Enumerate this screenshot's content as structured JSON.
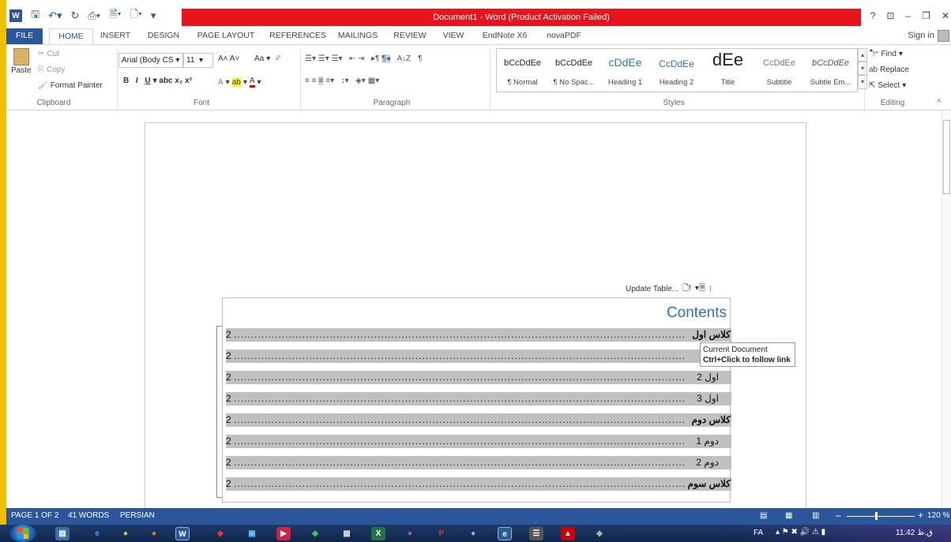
{
  "title_bar": {
    "title": "Document1 - Word (Product Activation Failed)"
  },
  "quick_access": {
    "icons": [
      "word-icon",
      "save-icon",
      "undo-icon",
      "redo-icon",
      "print-preview-icon",
      "new-doc-icon",
      "open-icon",
      "customize-icon"
    ]
  },
  "window_controls": {
    "help": "?",
    "ribbon_options": "⊡",
    "minimize": "–",
    "restore": "❐",
    "close": "✕"
  },
  "tabs": [
    {
      "label": "FILE"
    },
    {
      "label": "HOME"
    },
    {
      "label": "INSERT"
    },
    {
      "label": "DESIGN"
    },
    {
      "label": "PAGE LAYOUT"
    },
    {
      "label": "REFERENCES"
    },
    {
      "label": "MAILINGS"
    },
    {
      "label": "REVIEW"
    },
    {
      "label": "VIEW"
    },
    {
      "label": "EndNote X6"
    },
    {
      "label": "novaPDF"
    }
  ],
  "sign_in": "Sign in",
  "clipboard": {
    "paste": "Paste",
    "cut": "Cut",
    "copy": "Copy",
    "format_painter": "Format Painter",
    "label": "Clipboard"
  },
  "font": {
    "family": "Arial (Body CS",
    "size": "11",
    "label": "Font",
    "change_case": "Aa"
  },
  "paragraph": {
    "label": "Paragraph"
  },
  "styles": {
    "items": [
      {
        "sample": "bCcDdEe",
        "label": "¶ Normal"
      },
      {
        "sample": "bCcDdEe",
        "label": "¶ No Spac..."
      },
      {
        "sample": "cDdEe",
        "label": "Heading 1"
      },
      {
        "sample": "CcDdEe",
        "label": "Heading 2"
      },
      {
        "sample": "dEe",
        "label": "Title"
      },
      {
        "sample": "CcDdEe",
        "label": "Subtitle"
      },
      {
        "sample": "bCcDdEe",
        "label": "Subtle Em..."
      }
    ],
    "label": "Styles"
  },
  "editing": {
    "find": "Find",
    "replace": "Replace",
    "select": "Select",
    "label": "Editing"
  },
  "toc_toolbar": {
    "update": "Update Table..."
  },
  "toc": {
    "title": "Contents",
    "entries": [
      {
        "text": "کلاس اول",
        "page": "2",
        "bold": true
      },
      {
        "text": "1",
        "page": "2",
        "bold": false
      },
      {
        "text": "اول 2",
        "page": "2",
        "bold": false
      },
      {
        "text": "اول 3",
        "page": "2",
        "bold": false
      },
      {
        "text": "کلاس دوم",
        "page": "2",
        "bold": true
      },
      {
        "text": "دوم 1",
        "page": "2",
        "bold": false
      },
      {
        "text": "دوم 2",
        "page": "2",
        "bold": false
      },
      {
        "text": "کلاس سوم",
        "page": "2",
        "bold": true
      }
    ]
  },
  "tooltip": {
    "line1": "Current Document",
    "line2": "Ctrl+Click to follow link"
  },
  "status_bar": {
    "page": "PAGE 1 OF 2",
    "words": "41 WORDS",
    "language": "PERSIAN",
    "zoom": "120 %"
  },
  "taskbar": {
    "lang": "FA",
    "time": "11:42 ق.ظ"
  },
  "colors": {
    "accent": "#2b579a",
    "title_band": "#e8141c",
    "heading": "#2e74b5",
    "field_shade": "#c0c0c0"
  }
}
